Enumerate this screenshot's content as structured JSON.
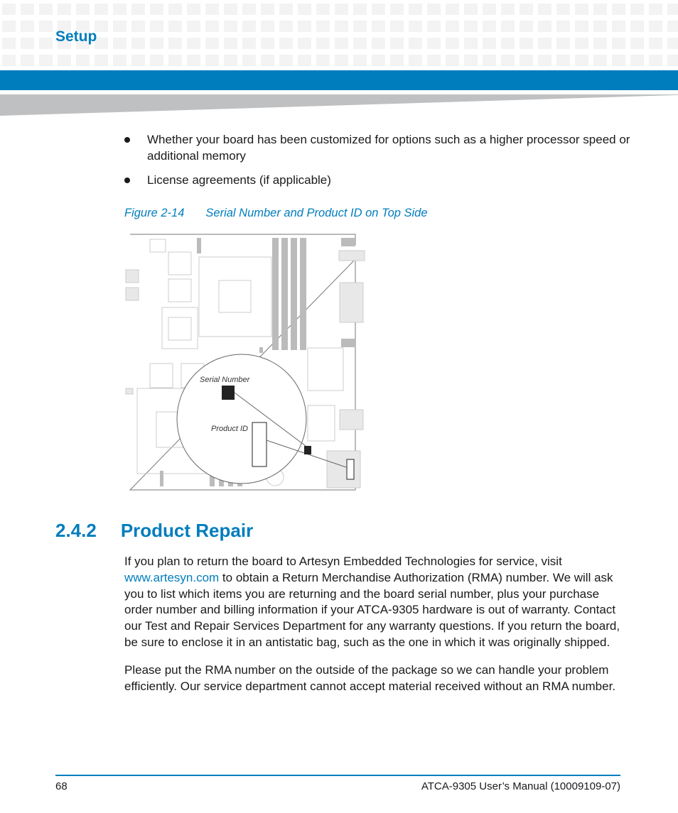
{
  "header": {
    "section": "Setup"
  },
  "bullets": [
    "Whether your board has been customized for options such as a higher processor speed or additional memory",
    "License agreements (if applicable)"
  ],
  "figure": {
    "number": "Figure 2-14",
    "title": "Serial Number and Product ID on Top Side",
    "labels": {
      "serial": "Serial Number",
      "product": "Product ID"
    }
  },
  "section": {
    "number": "2.4.2",
    "title": "Product Repair"
  },
  "paragraphs": {
    "p1_before": "If you plan to return the board to Artesyn Embedded Technologies for service, visit ",
    "p1_link": "www.artesyn.com",
    "p1_after": " to obtain a Return Merchandise Authorization (RMA) number. We will ask you to list which items you are returning and the board serial number, plus your purchase order number and billing information if your ATCA-9305 hardware is out of warranty. Contact our Test and Repair Services Department for any warranty questions. If you return the board, be sure to enclose it in an antistatic bag, such as the one in which it was originally shipped.",
    "p2": "Please put the RMA number on the outside of the package so we can handle your problem efficiently. Our service department cannot accept material received without an RMA number."
  },
  "footer": {
    "page": "68",
    "title": "ATCA-9305 User’s Manual (10009109-07)"
  },
  "colors": {
    "accent": "#007dbd",
    "wedge": "#bfc0c2"
  }
}
